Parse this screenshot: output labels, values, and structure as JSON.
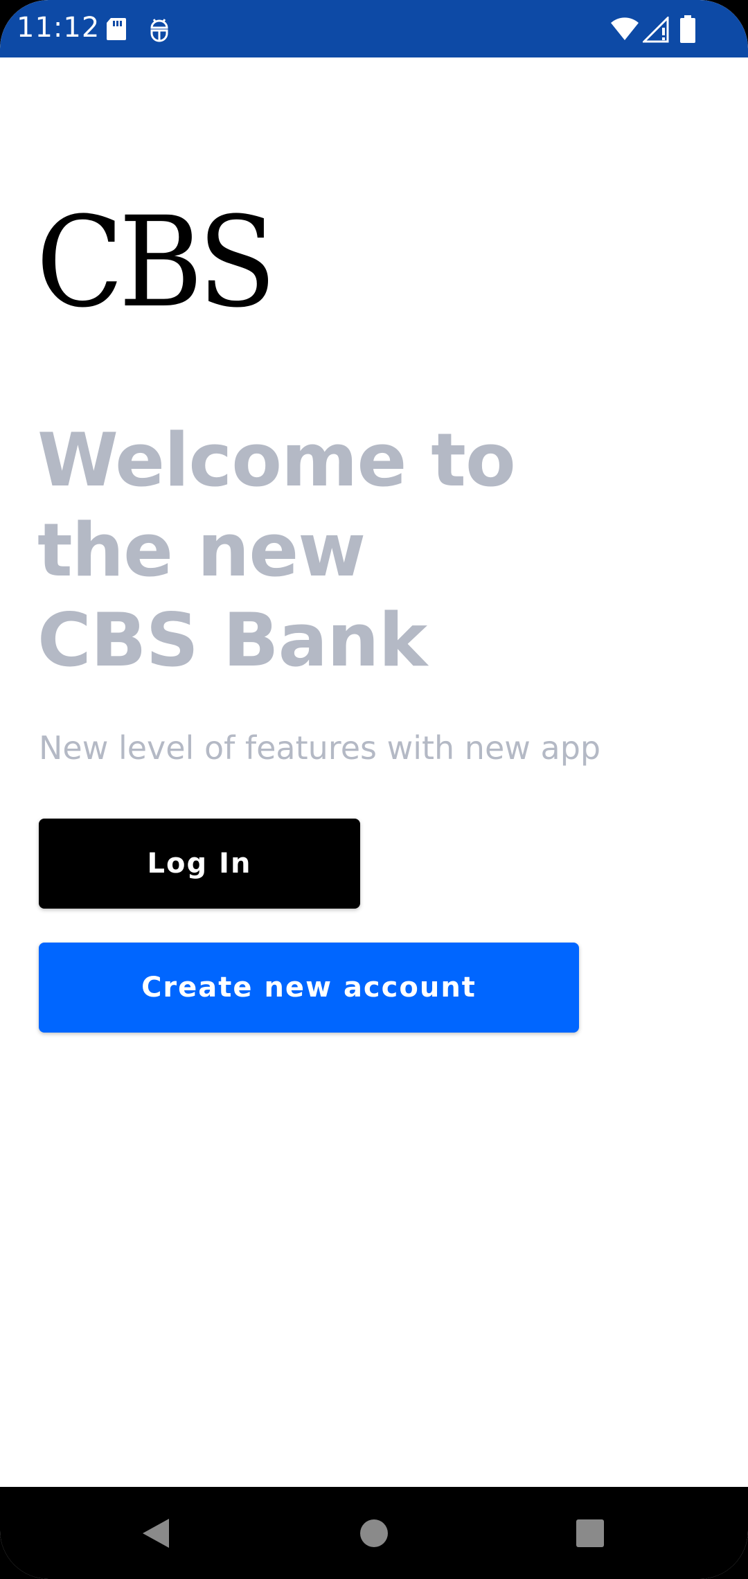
{
  "status_bar": {
    "time": "11:12",
    "background_color": "#0d4aa6",
    "icons": [
      "sd-card-icon",
      "debug-icon",
      "wifi-icon",
      "signal-icon",
      "battery-icon"
    ]
  },
  "logo": {
    "text": "CBS"
  },
  "welcome": {
    "line1": "Welcome to",
    "line2": "the new",
    "line3": "CBS Bank",
    "color": "#b4b9c5"
  },
  "subtitle": "New level of features with new app",
  "buttons": {
    "login_label": "Log In",
    "login_color": "#000000",
    "create_label": "Create new account",
    "create_color": "#0066ff"
  },
  "nav_bar": {
    "icons": [
      "back-icon",
      "home-icon",
      "recents-icon"
    ]
  }
}
